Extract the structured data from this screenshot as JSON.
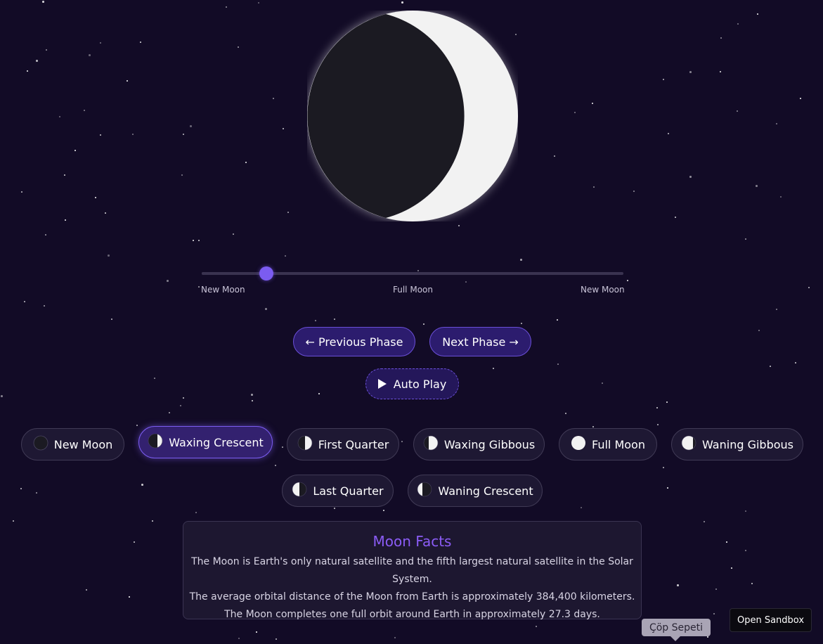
{
  "moon": {
    "phase_name": "Waxing Crescent",
    "illumination_side": "right",
    "colors": {
      "lit": "#f2f2f2",
      "dark": "#1b1a22",
      "glow": "#ffffff"
    }
  },
  "slider": {
    "value": 0.153,
    "labels": {
      "left": "New Moon",
      "middle": "Full Moon",
      "right": "New Moon"
    },
    "accent": "#7b5cf0"
  },
  "controls": {
    "previous_label": "← Previous Phase",
    "next_label": "Next Phase →",
    "autoplay_label": "Auto Play",
    "autoplay_icon": "play-icon"
  },
  "phases": [
    {
      "id": "new-moon",
      "label": "New Moon",
      "icon": "new-moon-icon",
      "active": false
    },
    {
      "id": "waxing-crescent",
      "label": "Waxing Crescent",
      "icon": "waxing-crescent-icon",
      "active": true
    },
    {
      "id": "first-quarter",
      "label": "First Quarter",
      "icon": "first-quarter-icon",
      "active": false
    },
    {
      "id": "waxing-gibbous",
      "label": "Waxing Gibbous",
      "icon": "waxing-gibbous-icon",
      "active": false
    },
    {
      "id": "full-moon",
      "label": "Full Moon",
      "icon": "full-moon-icon",
      "active": false
    },
    {
      "id": "waning-gibbous",
      "label": "Waning Gibbous",
      "icon": "waning-gibbous-icon",
      "active": false
    },
    {
      "id": "last-quarter",
      "label": "Last Quarter",
      "icon": "last-quarter-icon",
      "active": false
    },
    {
      "id": "waning-crescent",
      "label": "Waning Crescent",
      "icon": "waning-crescent-icon",
      "active": false
    }
  ],
  "facts": {
    "title": "Moon Facts",
    "items": [
      "The Moon is Earth's only natural satellite and the fifth largest natural satellite in the Solar System.",
      "The average orbital distance of the Moon from Earth is approximately 384,400 kilometers.",
      "The Moon completes one full orbit around Earth in approximately 27.3 days."
    ]
  },
  "overlay": {
    "trash_tooltip": "Çöp Sepeti",
    "open_sandbox_label": "Open Sandbox"
  },
  "theme": {
    "background": "#120b26",
    "accent": "#7b5cf0",
    "facts_title_color": "#8b5cf6"
  }
}
